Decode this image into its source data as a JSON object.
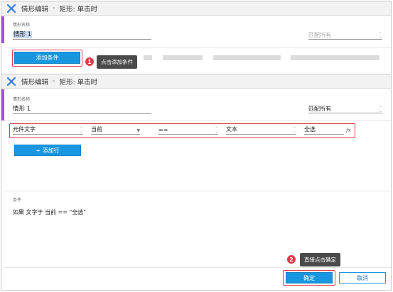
{
  "top_dialog": {
    "title": "情形编辑",
    "subtitle": "矩形: 单击时",
    "case_name_label": "情形名称",
    "case_name_value": "情形 1",
    "match_value": "匹配所有",
    "add_condition_label": "添加条件",
    "badge": "1",
    "tooltip": "点击添加条件"
  },
  "main_dialog": {
    "title": "情形编辑",
    "subtitle": "矩形: 单击时",
    "case_name_label": "情形名称",
    "case_name_value": "情形 1",
    "match_value": "匹配所有",
    "condition_row": {
      "type": "元件文字",
      "target": "当前",
      "operator": "==",
      "value_type": "文本",
      "value": "全选",
      "fx": "fx"
    },
    "add_row_label": "+ 添加行",
    "condition_section_label": "条件",
    "condition_text": "如果 文字于 当前 == \"全选\"",
    "badge": "2",
    "tooltip": "直接点击确定",
    "ok_label": "确定",
    "cancel_label": "取消"
  },
  "colors": {
    "accent": "#a44fe0",
    "primary": "#1896e0",
    "annotation": "#e03b4a"
  }
}
